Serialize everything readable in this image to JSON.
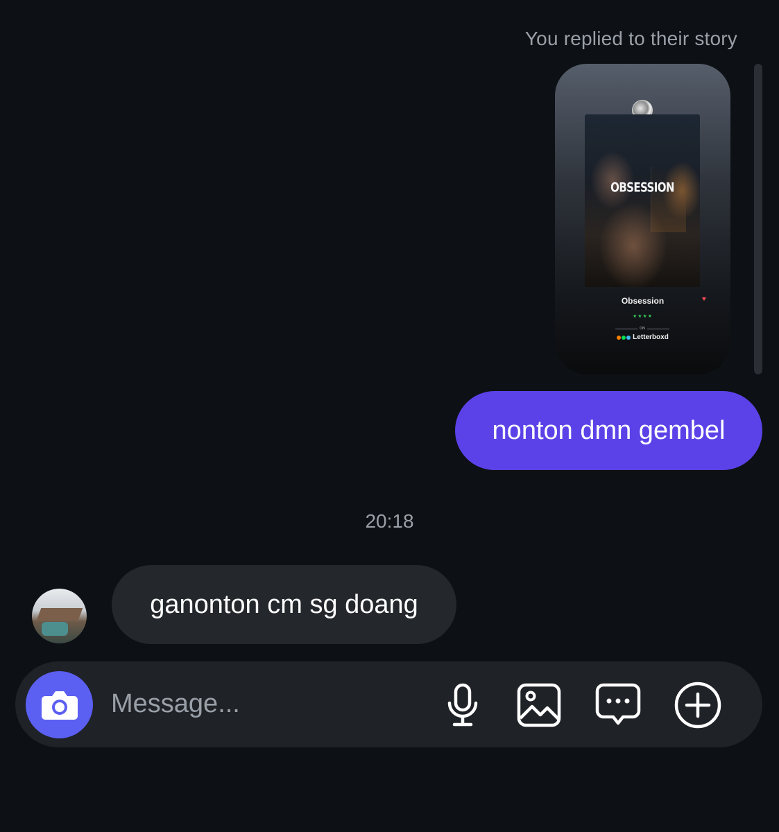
{
  "thread": {
    "reply_caption": "You replied to their story",
    "story": {
      "poster_title": "OBSESSION",
      "film_name": "Obsession",
      "heart_icon": "heart-icon",
      "rating_text": "★★★★",
      "on_text": "ON",
      "brand": "Letterboxd",
      "brand_dot_colors": [
        "#ff8000",
        "#00e054",
        "#40bcf4"
      ]
    },
    "sent_message": "nonton dmn gembel",
    "timestamp": "20:18",
    "received_message": "ganonton cm sg doang"
  },
  "composer": {
    "placeholder": "Message...",
    "icons": [
      "camera-icon",
      "microphone-icon",
      "image-icon",
      "chat-bubble-icon",
      "plus-circle-icon"
    ]
  },
  "colors": {
    "background": "#0d1014",
    "sent_bubble": "#5b42e8",
    "received_bubble": "#24272c",
    "camera_button": "#5b5ff2"
  }
}
